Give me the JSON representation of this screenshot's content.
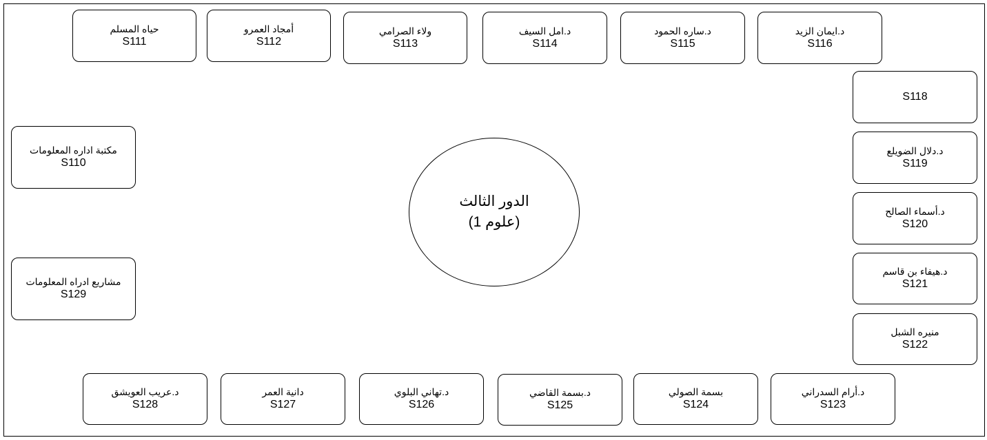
{
  "floor": {
    "title_line1": "الدور الثالث",
    "title_line2": "(علوم 1)"
  },
  "rooms": {
    "s111": {
      "name": "حياه المسلم",
      "code": "S111"
    },
    "s112": {
      "name": "أمجاد العمرو",
      "code": "S112"
    },
    "s113": {
      "name": "ولاء الصرامي",
      "code": "S113"
    },
    "s114": {
      "name": "د.امل السيف",
      "code": "S114"
    },
    "s115": {
      "name": "د.ساره الحمود",
      "code": "S115"
    },
    "s116": {
      "name": "د.ايمان الزيد",
      "code": "S116"
    },
    "s118": {
      "name": "",
      "code": "S118"
    },
    "s119": {
      "name": "د.دلال الضويلع",
      "code": "S119"
    },
    "s120": {
      "name": "د.أسماء الصالح",
      "code": "S120"
    },
    "s121": {
      "name": "د.هيفاء بن قاسم",
      "code": "S121"
    },
    "s122": {
      "name": "منيره الشبل",
      "code": "S122"
    },
    "s110": {
      "name": "مكتبة اداره المعلومات",
      "code": "S110"
    },
    "s129": {
      "name": "مشاريع ادراه المعلومات",
      "code": "S129"
    },
    "s128": {
      "name": "د.عريب العويشق",
      "code": "S128"
    },
    "s127": {
      "name": "دانية العمر",
      "code": "S127"
    },
    "s126": {
      "name": "د.تهاني البلوي",
      "code": "S126"
    },
    "s125": {
      "name": "د.بسمة القاضي",
      "code": "S125"
    },
    "s124": {
      "name": "بسمة الصولي",
      "code": "S124"
    },
    "s123": {
      "name": "د.أرام السدراني",
      "code": "S123"
    }
  }
}
